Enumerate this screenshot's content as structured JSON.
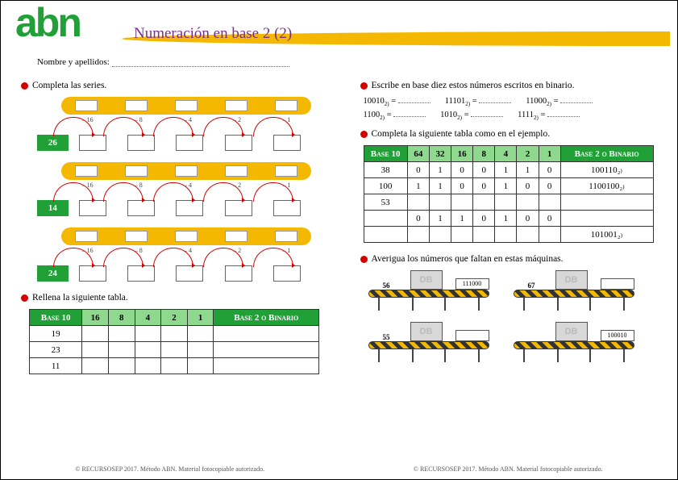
{
  "logo": "abn",
  "title": "Numeración en base 2 (2)",
  "name_label": "Nombre y apellidos:",
  "tasks": {
    "t1": "Completa las series.",
    "t2": "Rellena la siguiente tabla.",
    "t3": "Escribe en base diez estos números escritos en binario.",
    "t4": "Completa la siguiente tabla como en el ejemplo.",
    "t5": "Averigua los números que faltan en estas máquinas."
  },
  "series": {
    "subtractors": [
      "– 16",
      "– 8",
      "– 4",
      "– 2",
      "– 1"
    ],
    "starts": [
      "26",
      "14",
      "24"
    ]
  },
  "table1": {
    "headers": [
      "Base 10",
      "16",
      "8",
      "4",
      "2",
      "1",
      "Base 2 o Binario"
    ],
    "rows": [
      [
        "19",
        "",
        "",
        "",
        "",
        "",
        ""
      ],
      [
        "23",
        "",
        "",
        "",
        "",
        "",
        ""
      ],
      [
        "11",
        "",
        "",
        "",
        "",
        "",
        ""
      ]
    ]
  },
  "binary_eq": [
    {
      "bin": "10010",
      "sub": "2)"
    },
    {
      "bin": "11101",
      "sub": "2)"
    },
    {
      "bin": "11000",
      "sub": "2)"
    },
    {
      "bin": "1100",
      "sub": "2)"
    },
    {
      "bin": "1010",
      "sub": "2)"
    },
    {
      "bin": "1111",
      "sub": "2)"
    }
  ],
  "table2": {
    "headers": [
      "Base 10",
      "64",
      "32",
      "16",
      "8",
      "4",
      "2",
      "1",
      "Base 2 o Binario"
    ],
    "rows": [
      [
        "38",
        "0",
        "1",
        "0",
        "0",
        "1",
        "1",
        "0",
        "100110₂₎"
      ],
      [
        "100",
        "1",
        "1",
        "0",
        "0",
        "1",
        "0",
        "0",
        "1100100₂₎"
      ],
      [
        "53",
        "",
        "",
        "",
        "",
        "",
        "",
        "",
        ""
      ],
      [
        "",
        "0",
        "1",
        "1",
        "0",
        "1",
        "0",
        "0",
        ""
      ],
      [
        "",
        "",
        "",
        "",
        "",
        "",
        "",
        "",
        "101001₂₎"
      ]
    ]
  },
  "machines": [
    {
      "in": "56",
      "out": "111000"
    },
    {
      "in": "67",
      "out": ""
    },
    {
      "in": "55",
      "out": ""
    },
    {
      "in": "",
      "out": "100010"
    }
  ],
  "screen_text": "DB",
  "footer": "© RECURSOSEP 2017. Método ABN. Material fotocopiable autorizado."
}
